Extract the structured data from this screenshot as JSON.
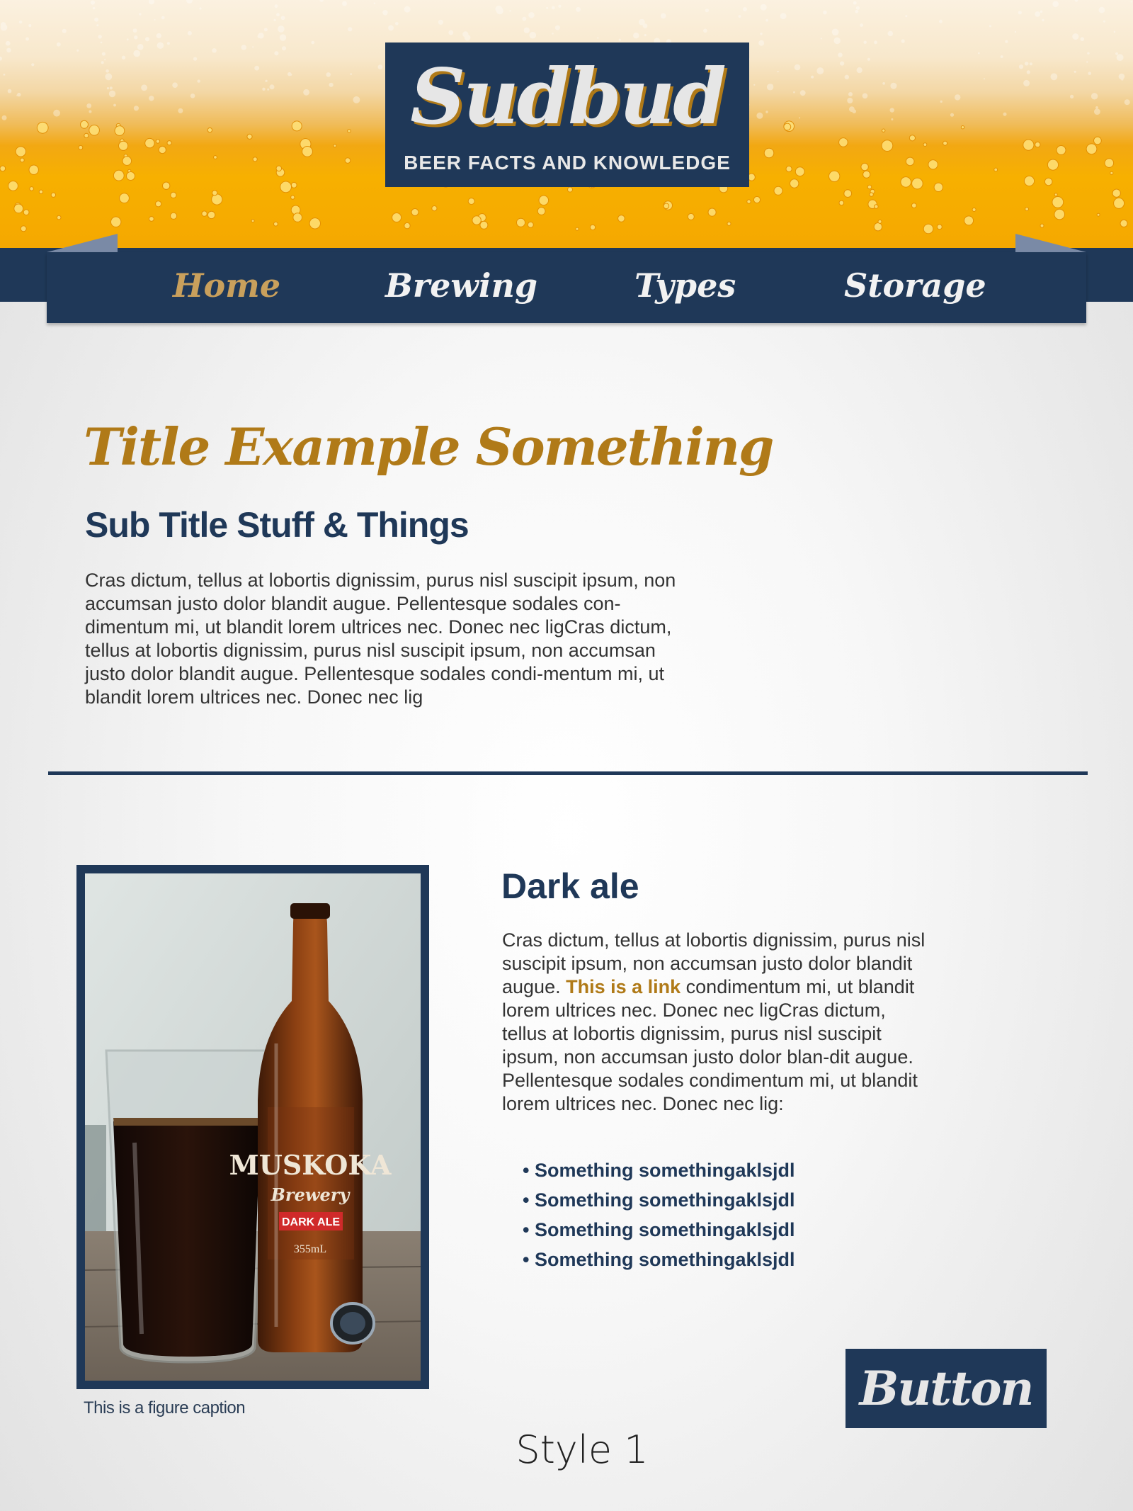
{
  "header": {
    "logo": "Sudbud",
    "tagline": "BEER FACTS AND KNOWLEDGE"
  },
  "nav": {
    "items": [
      {
        "label": "Home",
        "active": true
      },
      {
        "label": "Brewing",
        "active": false
      },
      {
        "label": "Types",
        "active": false
      },
      {
        "label": "Storage",
        "active": false
      }
    ]
  },
  "main": {
    "title": "Title Example Something",
    "subtitle": "Sub Title Stuff & Things",
    "intro": "Cras dictum, tellus at lobortis dignissim, purus nisl suscipit ipsum, non accumsan justo dolor blandit augue. Pellentesque sodales con-dimentum mi, ut blandit lorem ultrices nec. Donec nec ligCras dictum, tellus at lobortis dignissim, purus nisl suscipit ipsum, non accumsan justo dolor blandit augue. Pellentesque sodales condi-mentum mi, ut blandit lorem ultrices nec. Donec nec lig"
  },
  "figure": {
    "caption": "This is a figure caption",
    "bottle_label_brand": "MUSKOKA",
    "bottle_label_sub": "Brewery",
    "bottle_label_type": "DARK ALE",
    "bottle_label_volume": "355mL"
  },
  "article": {
    "title": "Dark ale",
    "text_before_link": "Cras dictum, tellus at lobortis dignissim, purus nisl suscipit ipsum, non accumsan justo dolor blandit augue. ",
    "link_text": "This is a link",
    "text_after_link": " condimentum mi, ut blandit lorem ultrices nec. Donec nec ligCras dictum, tellus at lobortis dignissim, purus nisl suscipit ipsum, non accumsan justo dolor blan-dit augue. Pellentesque sodales condimentum mi, ut blandit lorem ultrices nec. Donec nec lig:",
    "bullets": [
      "Something somethingaklsjdl",
      "Something somethingaklsjdl",
      "Something somethingaklsjdl",
      "Something somethingaklsjdl"
    ]
  },
  "button": {
    "label": "Button"
  },
  "footer": {
    "style_label": "Style 1"
  },
  "colors": {
    "navy": "#1f3858",
    "gold": "#b07a18",
    "nav_active": "#c9a05c",
    "beer": "#f5a800"
  }
}
